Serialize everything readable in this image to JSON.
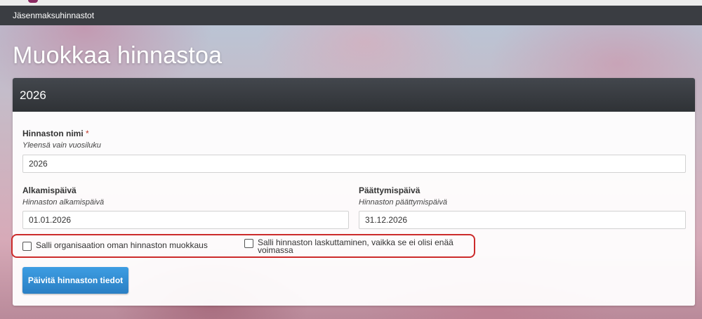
{
  "breadcrumb": "Jäsenmaksuhinnastot",
  "page_title": "Muokkaa hinnastoa",
  "panel": {
    "title": "2026"
  },
  "form": {
    "name": {
      "label": "Hinnaston nimi",
      "required_mark": "*",
      "help": "Yleensä vain vuosiluku",
      "value": "2026"
    },
    "start_date": {
      "label": "Alkamispäivä",
      "help": "Hinnaston alkamispäivä",
      "value": "01.01.2026"
    },
    "end_date": {
      "label": "Päättymispäivä",
      "help": "Hinnaston päättymispäivä",
      "value": "31.12.2026"
    },
    "checkbox_org_edit": {
      "label": "Salli organisaation oman hinnaston muokkaus",
      "checked": false
    },
    "checkbox_billing": {
      "label": "Salli hinnaston laskuttaminen, vaikka se ei olisi enää voimassa",
      "checked": false
    },
    "submit_label": "Päivitä hinnaston tiedot"
  },
  "colors": {
    "header_bar": "#3a3d42",
    "button": "#2a7fc4",
    "highlight": "#cc2b2b",
    "required": "#c0392b"
  }
}
